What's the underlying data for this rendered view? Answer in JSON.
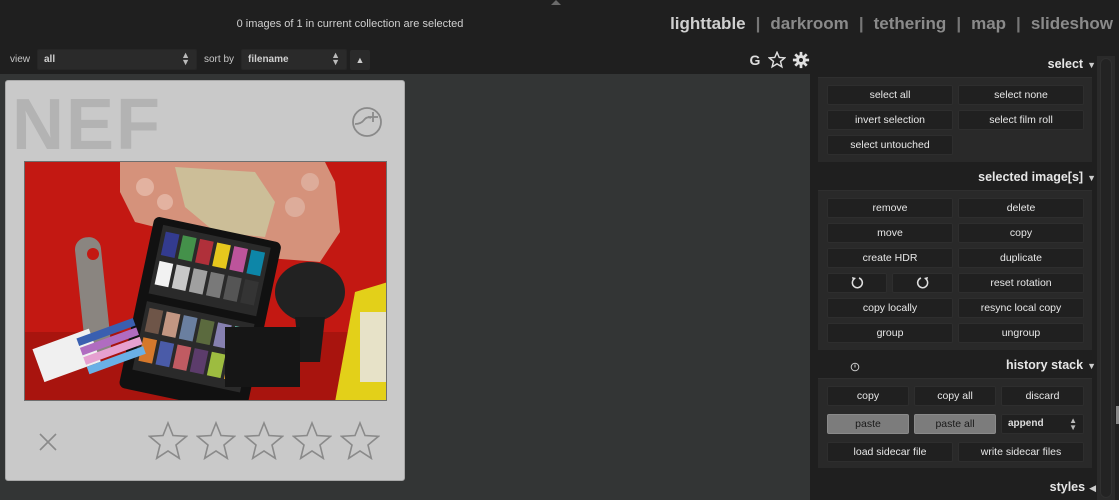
{
  "status": "0 images of 1 in current collection are selected",
  "views": [
    {
      "label": "lighttable",
      "active": true
    },
    {
      "label": "darkroom",
      "active": false
    },
    {
      "label": "tethering",
      "active": false
    },
    {
      "label": "map",
      "active": false
    },
    {
      "label": "slideshow",
      "active": false
    }
  ],
  "view_separator": "|",
  "filter": {
    "view_label": "view",
    "view_value": "all",
    "sort_label": "sort by",
    "sort_value": "filename",
    "sort_direction_icon": "triangle-up-icon",
    "grouping_label": "G",
    "icons": [
      "star-icon",
      "gear-icon"
    ]
  },
  "thumbnail": {
    "extension": "NEF",
    "rating_max": 5,
    "rating": 0,
    "icons": [
      "altered-icon",
      "reject-icon",
      "star-icon"
    ]
  },
  "select_module": {
    "title": "select",
    "buttons": [
      "select all",
      "select none",
      "invert selection",
      "select film roll",
      "select untouched"
    ]
  },
  "selected_images_module": {
    "title": "selected image[s]",
    "buttons": [
      "remove",
      "delete",
      "move",
      "copy",
      "create HDR",
      "duplicate",
      "reset rotation",
      "copy locally",
      "resync local copy",
      "group",
      "ungroup"
    ],
    "rotate_icons": [
      "rotate-ccw-icon",
      "rotate-cw-icon"
    ]
  },
  "history_stack_module": {
    "title": "history stack",
    "buttons": [
      "copy",
      "copy all",
      "discard",
      "paste",
      "paste all",
      "load sidecar file",
      "write sidecar files"
    ],
    "append_value": "append"
  },
  "styles_module": {
    "title": "styles"
  },
  "arrows": {
    "down": "▼",
    "left": "◀"
  }
}
